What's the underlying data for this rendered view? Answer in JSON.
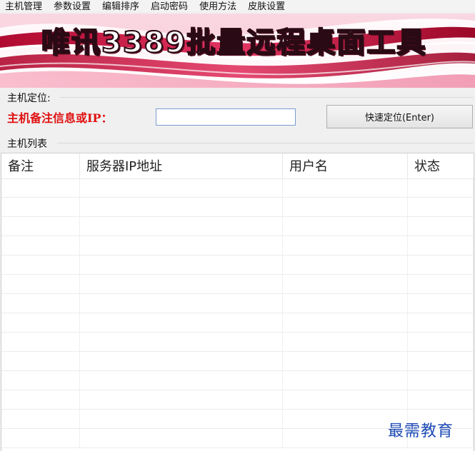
{
  "menu": {
    "items": [
      {
        "label": "主机管理"
      },
      {
        "label": "参数设置"
      },
      {
        "label": "编辑排序"
      },
      {
        "label": "启动密码"
      },
      {
        "label": "使用方法"
      },
      {
        "label": "皮肤设置"
      }
    ]
  },
  "banner": {
    "title": "唯讯3389批量远程桌面工具",
    "colors": {
      "accent": "#c8103c",
      "wave": "#e84a78",
      "highlight": "#fbd3de"
    }
  },
  "locate": {
    "group_label": "主机定位:",
    "field_label": "主机备注信息或IP：",
    "input_value": "",
    "button_label": "快速定位(Enter)"
  },
  "host_list": {
    "group_label": "主机列表",
    "columns": [
      {
        "label": "备注"
      },
      {
        "label": "服务器IP地址"
      },
      {
        "label": "用户名"
      },
      {
        "label": "状态"
      }
    ],
    "rows": []
  },
  "watermark": "最需教育"
}
